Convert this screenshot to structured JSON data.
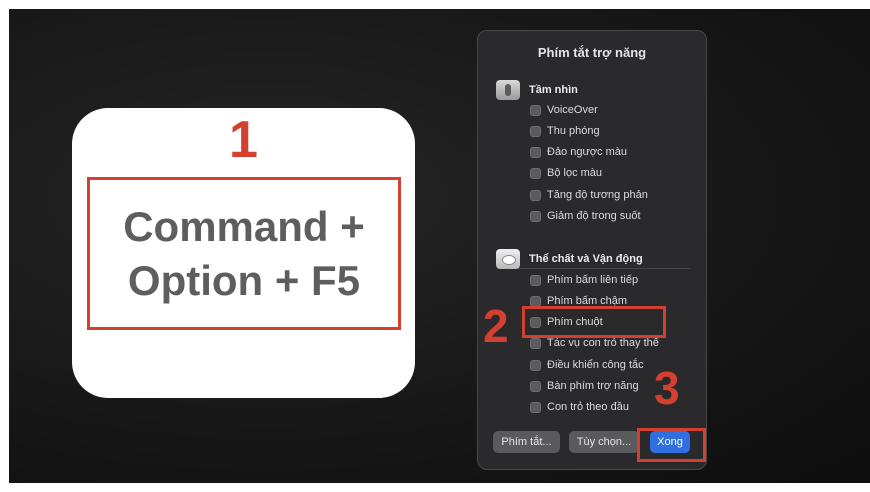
{
  "steps": {
    "one": "1",
    "two": "2",
    "three": "3"
  },
  "shortcut": {
    "line1": "Command +",
    "line2": "Option + F5"
  },
  "dialog": {
    "title": "Phím tắt trợ năng",
    "vision": {
      "header": "Tầm nhìn",
      "items": [
        "VoiceOver",
        "Thu phóng",
        "Đảo ngược màu",
        "Bộ lọc màu",
        "Tăng độ tương phản",
        "Giảm độ trong suốt"
      ]
    },
    "physical": {
      "header": "Thể chất và Vận động",
      "items": [
        "Phím bấm liên tiếp",
        "Phím bấm chậm",
        "Phím chuột",
        "Tác vụ con trỏ thay thế",
        "Điều khiển công tắc",
        "Bàn phím trợ năng",
        "Con trỏ theo đầu"
      ]
    },
    "buttons": {
      "shortcuts": "Phím tắt...",
      "options": "Tùy chọn...",
      "done": "Xong"
    }
  },
  "colors": {
    "accent_red": "#d4402f",
    "done_blue": "#2f6fe0",
    "dialog_bg": "#2a2a2c"
  },
  "icons": {
    "vision": "vision-icon",
    "physical": "physical-motor-icon"
  }
}
